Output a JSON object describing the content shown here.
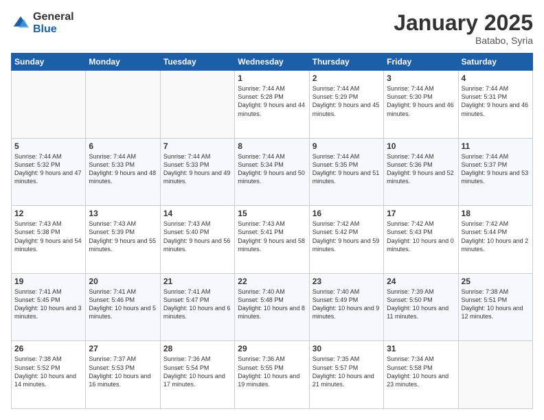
{
  "header": {
    "logo_general": "General",
    "logo_blue": "Blue",
    "month_title": "January 2025",
    "location": "Batabo, Syria"
  },
  "weekdays": [
    "Sunday",
    "Monday",
    "Tuesday",
    "Wednesday",
    "Thursday",
    "Friday",
    "Saturday"
  ],
  "weeks": [
    [
      {
        "day": "",
        "sunrise": "",
        "sunset": "",
        "daylight": ""
      },
      {
        "day": "",
        "sunrise": "",
        "sunset": "",
        "daylight": ""
      },
      {
        "day": "",
        "sunrise": "",
        "sunset": "",
        "daylight": ""
      },
      {
        "day": "1",
        "sunrise": "Sunrise: 7:44 AM",
        "sunset": "Sunset: 5:28 PM",
        "daylight": "Daylight: 9 hours and 44 minutes."
      },
      {
        "day": "2",
        "sunrise": "Sunrise: 7:44 AM",
        "sunset": "Sunset: 5:29 PM",
        "daylight": "Daylight: 9 hours and 45 minutes."
      },
      {
        "day": "3",
        "sunrise": "Sunrise: 7:44 AM",
        "sunset": "Sunset: 5:30 PM",
        "daylight": "Daylight: 9 hours and 46 minutes."
      },
      {
        "day": "4",
        "sunrise": "Sunrise: 7:44 AM",
        "sunset": "Sunset: 5:31 PM",
        "daylight": "Daylight: 9 hours and 46 minutes."
      }
    ],
    [
      {
        "day": "5",
        "sunrise": "Sunrise: 7:44 AM",
        "sunset": "Sunset: 5:32 PM",
        "daylight": "Daylight: 9 hours and 47 minutes."
      },
      {
        "day": "6",
        "sunrise": "Sunrise: 7:44 AM",
        "sunset": "Sunset: 5:33 PM",
        "daylight": "Daylight: 9 hours and 48 minutes."
      },
      {
        "day": "7",
        "sunrise": "Sunrise: 7:44 AM",
        "sunset": "Sunset: 5:33 PM",
        "daylight": "Daylight: 9 hours and 49 minutes."
      },
      {
        "day": "8",
        "sunrise": "Sunrise: 7:44 AM",
        "sunset": "Sunset: 5:34 PM",
        "daylight": "Daylight: 9 hours and 50 minutes."
      },
      {
        "day": "9",
        "sunrise": "Sunrise: 7:44 AM",
        "sunset": "Sunset: 5:35 PM",
        "daylight": "Daylight: 9 hours and 51 minutes."
      },
      {
        "day": "10",
        "sunrise": "Sunrise: 7:44 AM",
        "sunset": "Sunset: 5:36 PM",
        "daylight": "Daylight: 9 hours and 52 minutes."
      },
      {
        "day": "11",
        "sunrise": "Sunrise: 7:44 AM",
        "sunset": "Sunset: 5:37 PM",
        "daylight": "Daylight: 9 hours and 53 minutes."
      }
    ],
    [
      {
        "day": "12",
        "sunrise": "Sunrise: 7:43 AM",
        "sunset": "Sunset: 5:38 PM",
        "daylight": "Daylight: 9 hours and 54 minutes."
      },
      {
        "day": "13",
        "sunrise": "Sunrise: 7:43 AM",
        "sunset": "Sunset: 5:39 PM",
        "daylight": "Daylight: 9 hours and 55 minutes."
      },
      {
        "day": "14",
        "sunrise": "Sunrise: 7:43 AM",
        "sunset": "Sunset: 5:40 PM",
        "daylight": "Daylight: 9 hours and 56 minutes."
      },
      {
        "day": "15",
        "sunrise": "Sunrise: 7:43 AM",
        "sunset": "Sunset: 5:41 PM",
        "daylight": "Daylight: 9 hours and 58 minutes."
      },
      {
        "day": "16",
        "sunrise": "Sunrise: 7:42 AM",
        "sunset": "Sunset: 5:42 PM",
        "daylight": "Daylight: 9 hours and 59 minutes."
      },
      {
        "day": "17",
        "sunrise": "Sunrise: 7:42 AM",
        "sunset": "Sunset: 5:43 PM",
        "daylight": "Daylight: 10 hours and 0 minutes."
      },
      {
        "day": "18",
        "sunrise": "Sunrise: 7:42 AM",
        "sunset": "Sunset: 5:44 PM",
        "daylight": "Daylight: 10 hours and 2 minutes."
      }
    ],
    [
      {
        "day": "19",
        "sunrise": "Sunrise: 7:41 AM",
        "sunset": "Sunset: 5:45 PM",
        "daylight": "Daylight: 10 hours and 3 minutes."
      },
      {
        "day": "20",
        "sunrise": "Sunrise: 7:41 AM",
        "sunset": "Sunset: 5:46 PM",
        "daylight": "Daylight: 10 hours and 5 minutes."
      },
      {
        "day": "21",
        "sunrise": "Sunrise: 7:41 AM",
        "sunset": "Sunset: 5:47 PM",
        "daylight": "Daylight: 10 hours and 6 minutes."
      },
      {
        "day": "22",
        "sunrise": "Sunrise: 7:40 AM",
        "sunset": "Sunset: 5:48 PM",
        "daylight": "Daylight: 10 hours and 8 minutes."
      },
      {
        "day": "23",
        "sunrise": "Sunrise: 7:40 AM",
        "sunset": "Sunset: 5:49 PM",
        "daylight": "Daylight: 10 hours and 9 minutes."
      },
      {
        "day": "24",
        "sunrise": "Sunrise: 7:39 AM",
        "sunset": "Sunset: 5:50 PM",
        "daylight": "Daylight: 10 hours and 11 minutes."
      },
      {
        "day": "25",
        "sunrise": "Sunrise: 7:38 AM",
        "sunset": "Sunset: 5:51 PM",
        "daylight": "Daylight: 10 hours and 12 minutes."
      }
    ],
    [
      {
        "day": "26",
        "sunrise": "Sunrise: 7:38 AM",
        "sunset": "Sunset: 5:52 PM",
        "daylight": "Daylight: 10 hours and 14 minutes."
      },
      {
        "day": "27",
        "sunrise": "Sunrise: 7:37 AM",
        "sunset": "Sunset: 5:53 PM",
        "daylight": "Daylight: 10 hours and 16 minutes."
      },
      {
        "day": "28",
        "sunrise": "Sunrise: 7:36 AM",
        "sunset": "Sunset: 5:54 PM",
        "daylight": "Daylight: 10 hours and 17 minutes."
      },
      {
        "day": "29",
        "sunrise": "Sunrise: 7:36 AM",
        "sunset": "Sunset: 5:55 PM",
        "daylight": "Daylight: 10 hours and 19 minutes."
      },
      {
        "day": "30",
        "sunrise": "Sunrise: 7:35 AM",
        "sunset": "Sunset: 5:57 PM",
        "daylight": "Daylight: 10 hours and 21 minutes."
      },
      {
        "day": "31",
        "sunrise": "Sunrise: 7:34 AM",
        "sunset": "Sunset: 5:58 PM",
        "daylight": "Daylight: 10 hours and 23 minutes."
      },
      {
        "day": "",
        "sunrise": "",
        "sunset": "",
        "daylight": ""
      }
    ]
  ]
}
